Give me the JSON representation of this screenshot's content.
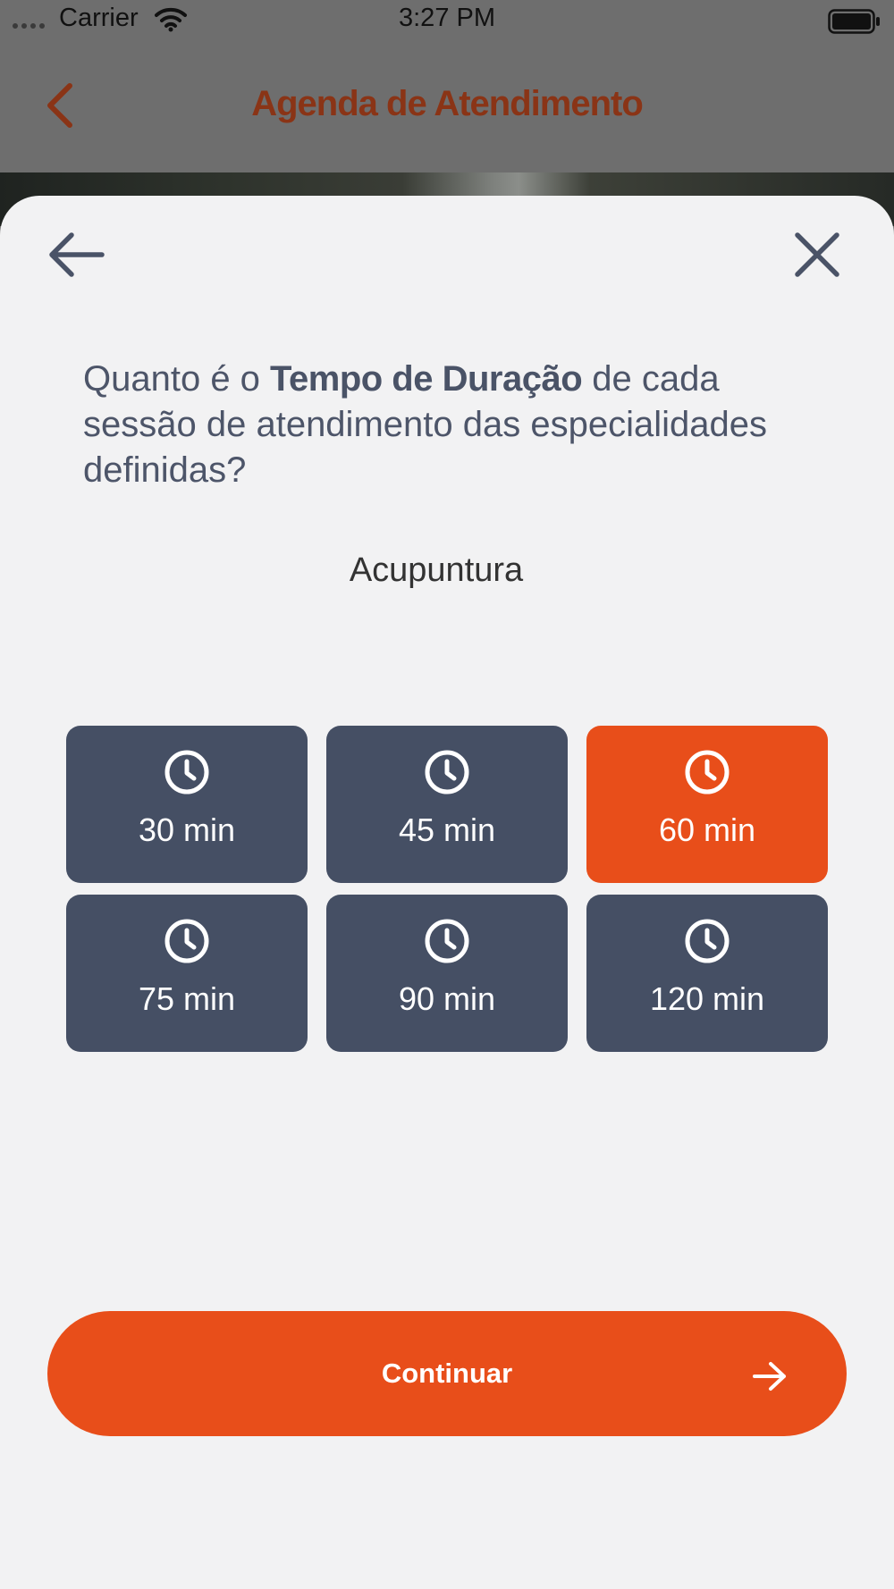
{
  "status_bar": {
    "carrier": "Carrier",
    "time": "3:27 PM",
    "icons": [
      "signal-dots-icon",
      "wifi-icon",
      "battery-icon"
    ]
  },
  "background_header": {
    "title": "Agenda de Atendimento",
    "back_icon": "chevron-left-icon",
    "title_color": "#8a3416"
  },
  "sheet": {
    "back_icon": "arrow-left-icon",
    "close_icon": "close-icon",
    "question": {
      "prefix": "Quanto é o ",
      "bold": "Tempo de Duração",
      "suffix": " de cada sessão de atendimento das especialidades definidas?"
    },
    "specialty": "Acupuntura",
    "options": [
      {
        "label": "30 min",
        "selected": false
      },
      {
        "label": "45 min",
        "selected": false
      },
      {
        "label": "60 min",
        "selected": true
      },
      {
        "label": "75 min",
        "selected": false
      },
      {
        "label": "90 min",
        "selected": false
      },
      {
        "label": "120 min",
        "selected": false
      }
    ],
    "continue_label": "Continuar",
    "continue_icon": "arrow-right-icon"
  },
  "colors": {
    "accent": "#e84e1a",
    "option_bg": "#454f64",
    "sheet_bg": "#f2f2f3",
    "text": "#4d5569"
  }
}
